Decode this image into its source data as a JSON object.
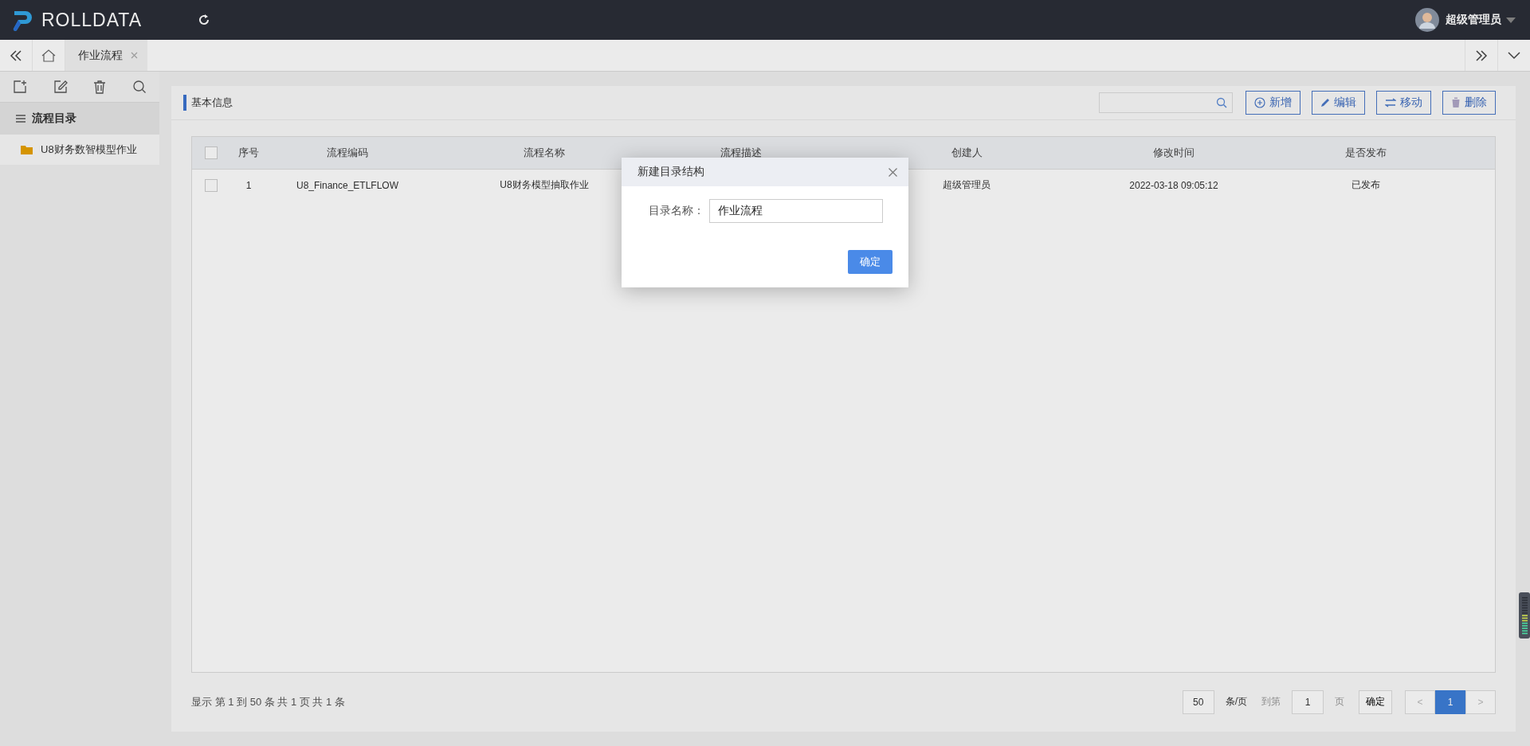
{
  "app": {
    "logo_text": "ROLLDATA",
    "user": "超级管理员"
  },
  "tabs": [
    {
      "label": "作业流程",
      "selected": true
    }
  ],
  "sidebar": {
    "title": "流程目录",
    "items": [
      {
        "label": "U8财务数智模型作业",
        "kind": "folder"
      }
    ]
  },
  "panel": {
    "title": "基本信息",
    "buttons": [
      {
        "label": "新增",
        "kind": "add"
      },
      {
        "label": "编辑",
        "kind": "edit"
      },
      {
        "label": "移动",
        "kind": "move"
      },
      {
        "label": "删除",
        "kind": "delete"
      }
    ]
  },
  "table": {
    "header_checked": false,
    "columns": [
      "序号",
      "流程编码",
      "流程名称",
      "流程描述",
      "创建人",
      "修改时间",
      "是否发布"
    ],
    "rows": [
      {
        "checked": false,
        "index": "1",
        "code": "U8_Finance_ETLFLOW",
        "name": "U8财务模型抽取作业",
        "creator": "超级管理员",
        "modified": "2022-03-18 09:05:12",
        "published": "已发布"
      }
    ]
  },
  "pagination": {
    "summary": "显示 第 1 到 50 条 共 1 页 共 1 条",
    "page_size": "50",
    "page_size_unit": "条/页",
    "goto_label": "到第",
    "goto_value": "1",
    "page_unit": "页",
    "confirm": "确定",
    "prev": "<",
    "next": ">",
    "pages": [
      {
        "label": "1",
        "selected": true
      }
    ]
  },
  "dialog": {
    "title": "新建目录结构",
    "field_label": "目录名称：",
    "field_value": "作业流程",
    "confirm": "确定"
  }
}
